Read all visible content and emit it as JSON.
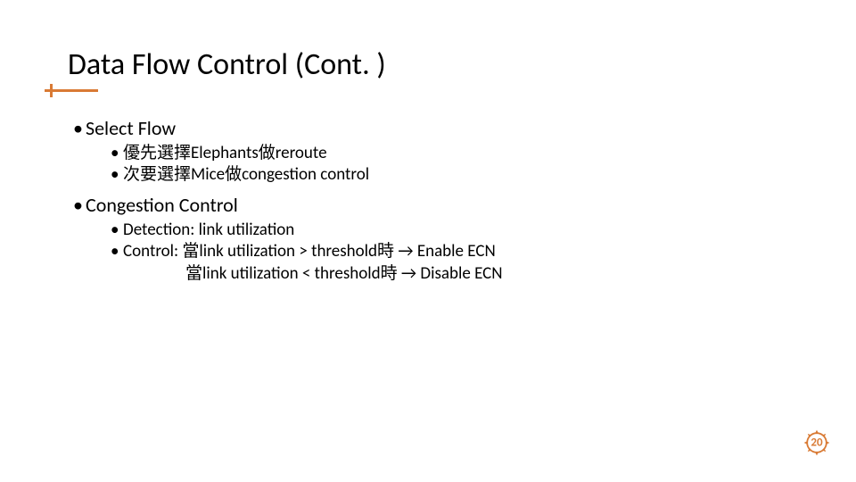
{
  "title": "Data Flow Control (Cont. )",
  "sections": {
    "selectFlow": {
      "heading": "Select Flow",
      "items": [
        "優先選擇Elephants做reroute",
        "次要選擇Mice做congestion control"
      ]
    },
    "congestionControl": {
      "heading": "Congestion Control",
      "items": [
        "Detection: link utilization",
        "Control: 當link utilization > threshold時 → Enable ECN"
      ],
      "continuation": "當link utilization < threshold時 → Disable ECN"
    }
  },
  "pageNumber": "20"
}
